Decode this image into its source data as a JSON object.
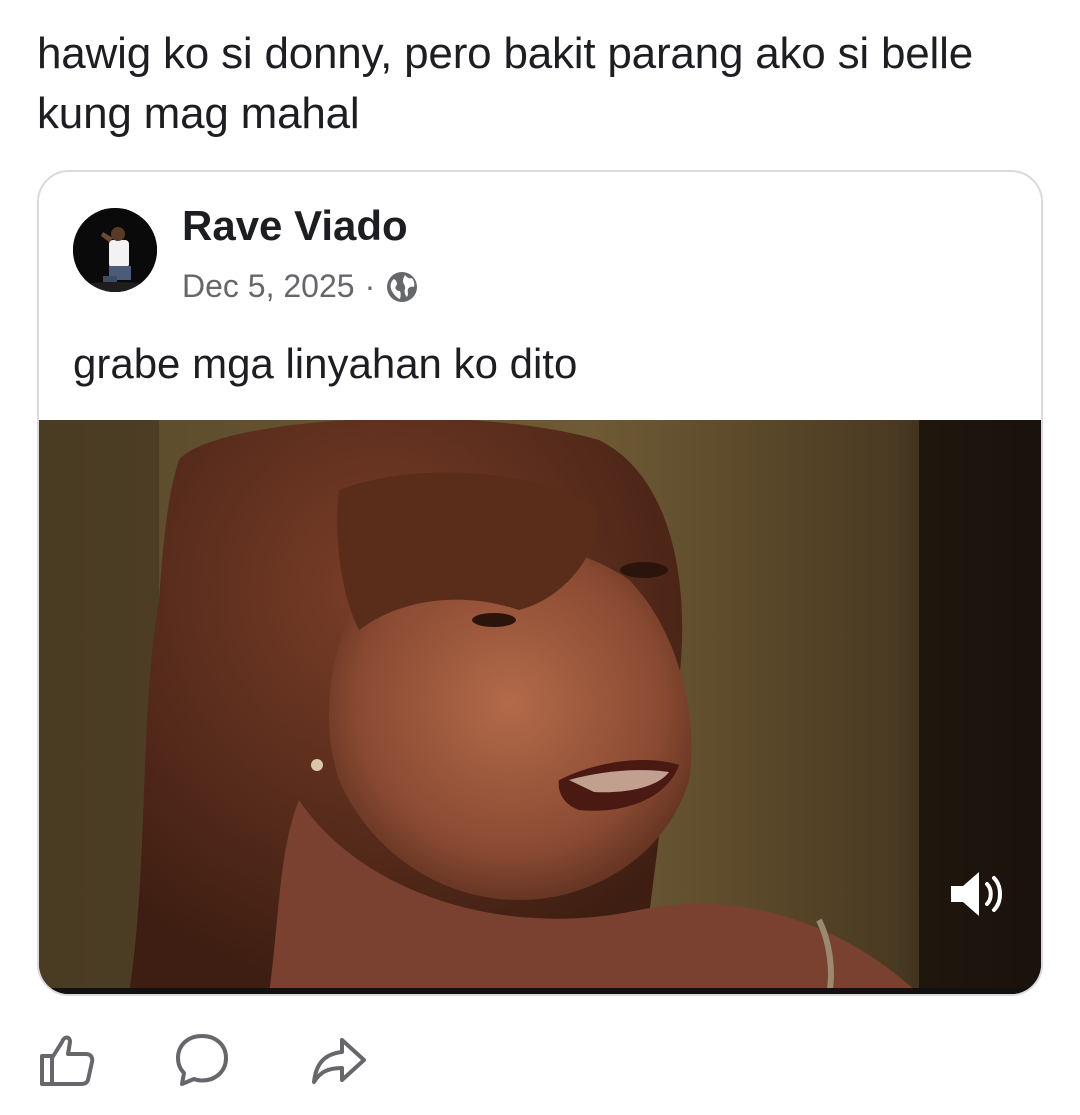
{
  "post": {
    "caption": "hawig ko si donny, pero bakit parang ako si belle kung mag mahal"
  },
  "shared": {
    "author": "Rave Viado",
    "date": "Dec 5, 2025",
    "separator": "·",
    "privacy_icon": "globe-icon",
    "text": "grabe mga linyahan ko dito",
    "video": {
      "muted": false,
      "sound_icon": "speaker-icon"
    }
  },
  "actions": {
    "icons": [
      "like-icon",
      "comment-icon",
      "share-icon"
    ]
  },
  "colors": {
    "text": "#1c1e21",
    "secondary_text": "#65676b",
    "card_border": "#d8dadf"
  }
}
